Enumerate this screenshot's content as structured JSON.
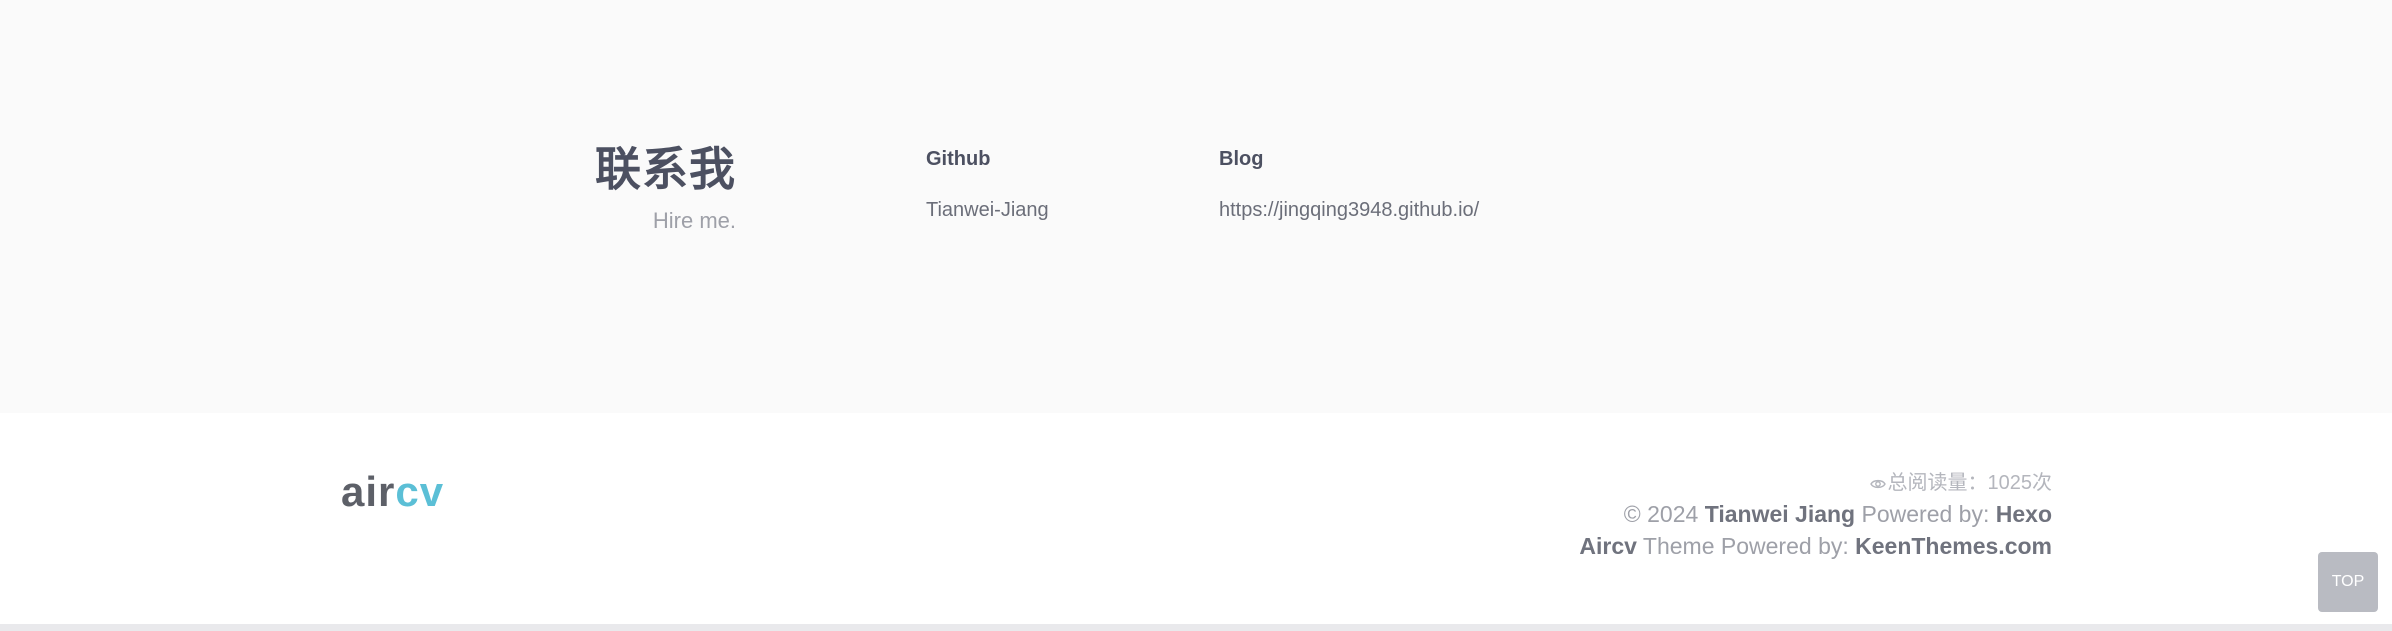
{
  "contact": {
    "title": "联系我",
    "subtitle": "Hire me.",
    "columns": [
      {
        "title": "Github",
        "link_text": "Tianwei-Jiang"
      },
      {
        "title": "Blog",
        "link_text": "https://jingqing3948.github.io/"
      }
    ]
  },
  "footer": {
    "logo": {
      "part1": "air",
      "part2": "cv"
    },
    "read_count": {
      "icon": "eye-icon",
      "text": "总阅读量：1025次"
    },
    "copyright": {
      "prefix": "© 2024 ",
      "author": "Tianwei Jiang",
      "powered_label": " Powered by: ",
      "engine": "Hexo"
    },
    "theme": {
      "name": "Aircv",
      "label": " Theme Powered by: ",
      "provider": "KeenThemes.com"
    }
  },
  "top_button": {
    "label": "TOP"
  },
  "colors": {
    "contact_bg": "#fafafa",
    "heading": "#4c5061",
    "muted": "#9ea0a8",
    "logo_accent": "#5bbfd6",
    "top_button_bg": "#b9bbc2"
  }
}
